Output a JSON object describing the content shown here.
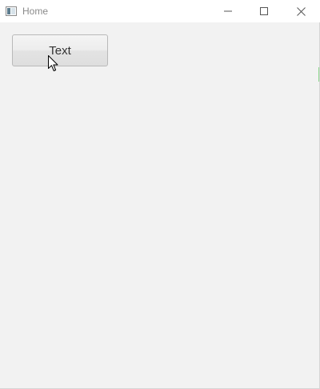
{
  "window": {
    "title": "Home",
    "app_icon": "window-app-icon",
    "controls": {
      "minimize_icon": "minimize-icon",
      "maximize_icon": "maximize-icon",
      "close_icon": "close-icon"
    }
  },
  "main": {
    "button_label": "Text"
  },
  "pointer": {
    "icon": "mouse-cursor-icon"
  },
  "colors": {
    "background": "#f2f2f2",
    "titlebar": "#ffffff",
    "title_text": "#8a8a8a",
    "button_border": "#b9b9b9",
    "button_text": "#333333"
  }
}
